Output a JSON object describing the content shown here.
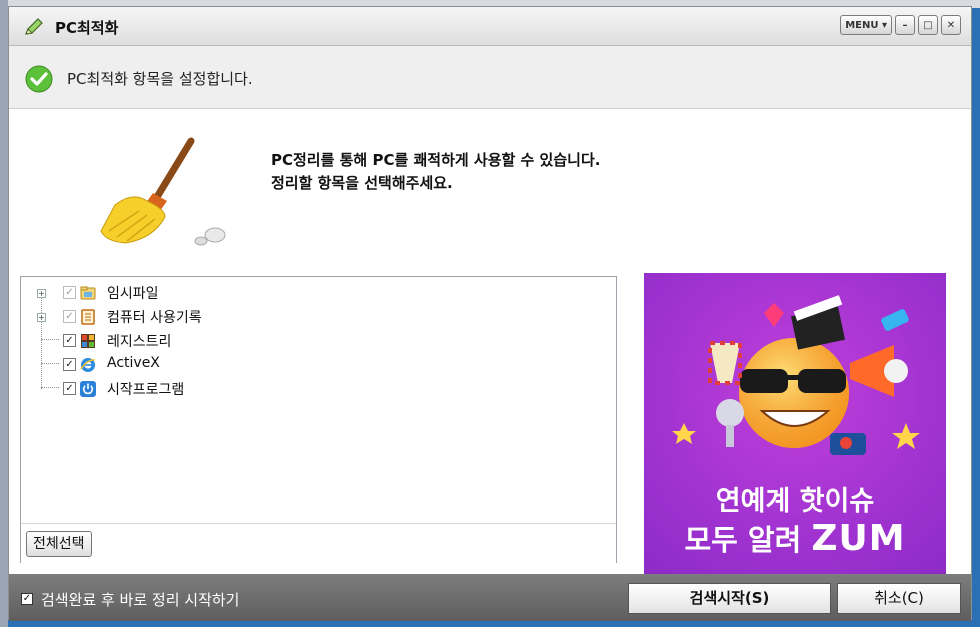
{
  "window": {
    "title": "PC최적화",
    "menu_label": "MENU ▾",
    "minimize_label": "–",
    "maximize_label": "□",
    "close_label": "✕"
  },
  "subheader": {
    "text": "PC최적화 항목을 설정합니다."
  },
  "headline": {
    "line1": "PC정리를 통해 PC를 쾌적하게 사용할 수 있습니다.",
    "line2": "정리할 항목을 선택해주세요."
  },
  "tree": {
    "items": [
      {
        "label": "임시파일",
        "checked": true,
        "dim": true,
        "expandable": true,
        "icon": "folder-icon"
      },
      {
        "label": "컴퓨터 사용기록",
        "checked": true,
        "dim": true,
        "expandable": true,
        "icon": "history-icon"
      },
      {
        "label": "레지스트리",
        "checked": true,
        "dim": false,
        "expandable": false,
        "icon": "registry-icon"
      },
      {
        "label": "ActiveX",
        "checked": true,
        "dim": false,
        "expandable": false,
        "icon": "ie-icon"
      },
      {
        "label": "시작프로그램",
        "checked": true,
        "dim": false,
        "expandable": false,
        "icon": "power-icon"
      }
    ],
    "select_all_label": "전체선택"
  },
  "ad": {
    "line1": "연예계 핫이슈",
    "line2_prefix": "모두 알려 ",
    "brand": "ZUM",
    "colors": {
      "background": "#a334d2"
    }
  },
  "footer": {
    "auto_clean_label": "검색완료 후 바로 정리 시작하기",
    "auto_clean_checked": true,
    "start_label": "검색시작(S)",
    "cancel_label": "취소(C)"
  }
}
